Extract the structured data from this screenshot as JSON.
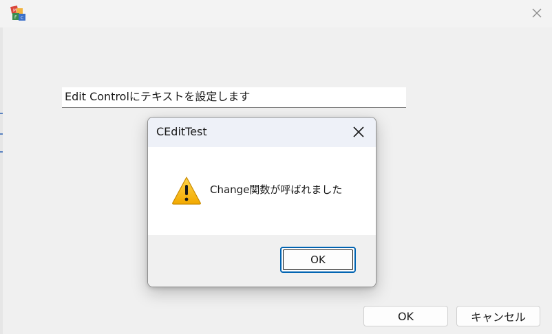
{
  "main_window": {
    "title_icon": "mfc-app-icon",
    "close_icon": "close-icon",
    "edit_text": "Edit Controlにテキストを設定します",
    "ok_label": "OK",
    "cancel_label": "キャンセル"
  },
  "message_box": {
    "title": "CEditTest",
    "close_icon": "close-icon",
    "icon": "warning-icon",
    "message": "Change関数が呼ばれました",
    "ok_label": "OK"
  },
  "colors": {
    "window_bg": "#f0f0f0",
    "dialog_titlebar": "#eef1f8",
    "focus_border": "#0063b1",
    "warning_fill": "#ffc107"
  }
}
